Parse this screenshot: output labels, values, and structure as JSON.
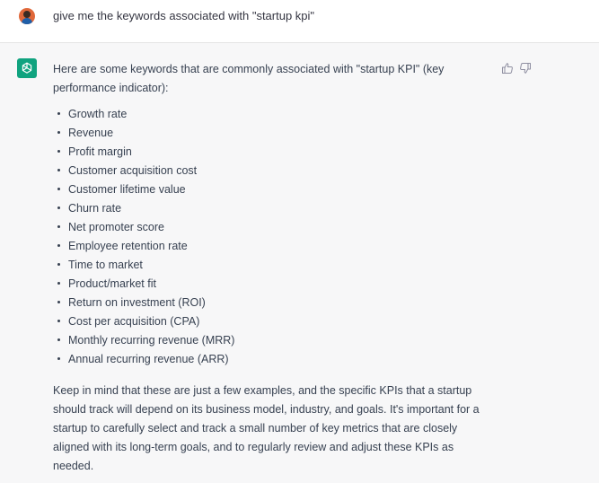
{
  "user_message": {
    "text": "give me the keywords associated with \"startup kpi\""
  },
  "assistant_message": {
    "intro": "Here are some keywords that are commonly associated with \"startup KPI\" (key performance indicator):",
    "keywords": [
      "Growth rate",
      "Revenue",
      "Profit margin",
      "Customer acquisition cost",
      "Customer lifetime value",
      "Churn rate",
      "Net promoter score",
      "Employee retention rate",
      "Time to market",
      "Product/market fit",
      "Return on investment (ROI)",
      "Cost per acquisition (CPA)",
      "Monthly recurring revenue (MRR)",
      "Annual recurring revenue (ARR)"
    ],
    "outro": "Keep in mind that these are just a few examples, and the specific KPIs that a startup should track will depend on its business model, industry, and goals. It's important for a startup to carefully select and track a small number of key metrics that are closely aligned with its long-term goals, and to regularly review and adjust these KPIs as needed."
  },
  "icons": {
    "user_avatar": "user-avatar",
    "assistant_avatar": "chatgpt-logo-icon",
    "thumbs_up": "thumbs-up-icon",
    "thumbs_down": "thumbs-down-icon"
  },
  "colors": {
    "assistant_bg": "#f7f7f8",
    "brand_green": "#10a37f",
    "text": "#374151"
  }
}
